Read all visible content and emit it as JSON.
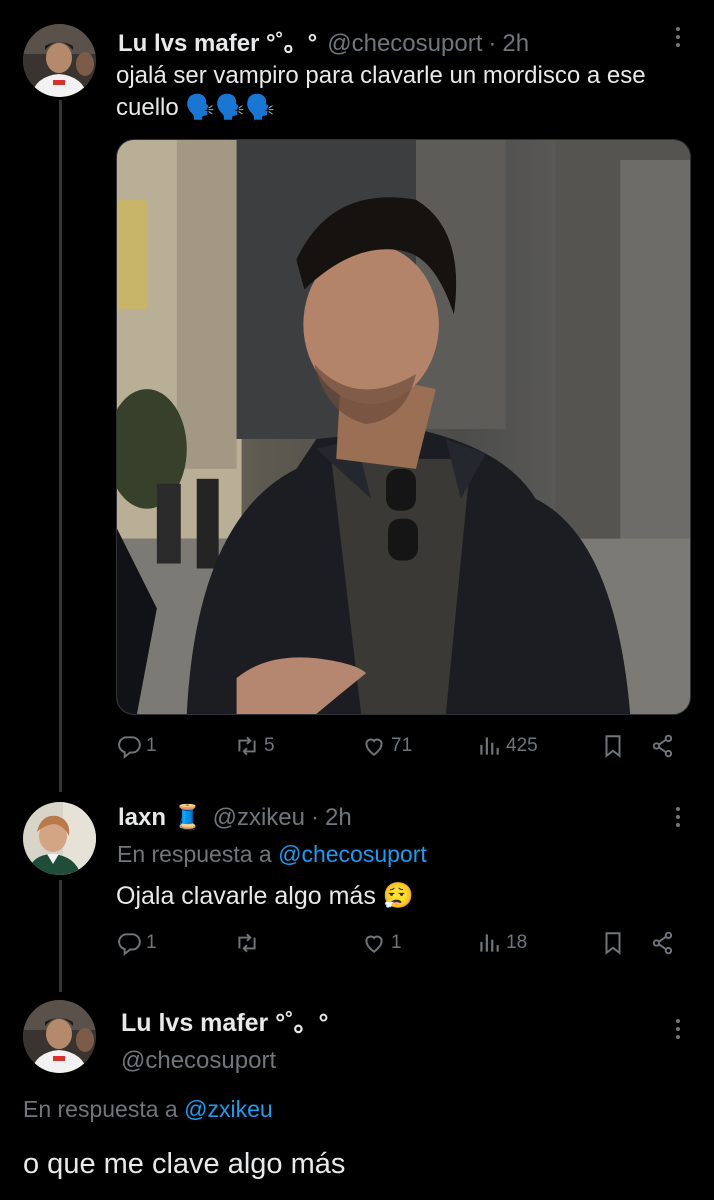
{
  "tweet1": {
    "name": "Lu lvs mafer °˚。°",
    "handle": "@checosuport",
    "time": "2h",
    "text": "ojalá ser vampiro para clavarle un mordisco a ese cuello 🗣️🗣️🗣️",
    "stats": {
      "replies": "1",
      "retweets": "5",
      "likes": "71",
      "views": "425"
    }
  },
  "tweet2": {
    "name": "laxn 🧵",
    "handle": "@zxikeu",
    "time": "2h",
    "reply_prefix": "En respuesta a",
    "reply_handle": "@checosuport",
    "text": "Ojala clavarle algo más 😮‍💨",
    "stats": {
      "replies": "1",
      "retweets": "",
      "likes": "1",
      "views": "18"
    }
  },
  "tweet3": {
    "name": "Lu lvs mafer °˚。°",
    "handle": "@checosuport",
    "reply_prefix": "En respuesta a",
    "reply_handle": "@zxikeu",
    "text": "o que me clave algo más"
  },
  "colors": {
    "background": "#000000",
    "text": "#e7e9ea",
    "muted": "#71767b",
    "link": "#1d9bf0",
    "thread_line": "#333639"
  },
  "icons": [
    "reply-icon",
    "retweet-icon",
    "like-icon",
    "views-icon",
    "bookmark-icon",
    "share-icon",
    "more-icon"
  ]
}
